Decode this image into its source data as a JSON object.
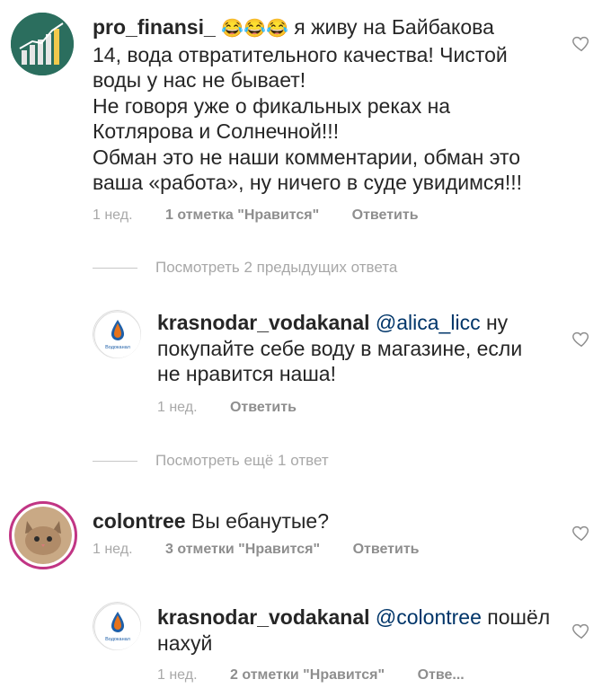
{
  "comments": {
    "c1": {
      "username": "pro_finansi_",
      "emojis": "😂😂😂",
      "text_lines": [
        "я живу на Байбакова",
        "14, вода отвратительного качества! Чистой",
        "воды у нас не бывает!",
        "Не говоря уже о фикальных реках на",
        "Котлярова и Солнечной!!!",
        "Обман это не наши комментарии, обман это",
        "ваша «работа», ну ничего в суде увидимся!!!"
      ],
      "time": "1 нед.",
      "likes": "1 отметка \"Нравится\"",
      "reply": "Ответить"
    },
    "view_prev": "Посмотреть 2 предыдущих ответа",
    "r1": {
      "username": "krasnodar_vodakanal",
      "mention": "@alica_licc",
      "text_lines": [
        "ну",
        "покупайте себе воду в магазине, если",
        "не нравится наша!"
      ],
      "time": "1 нед.",
      "reply": "Ответить",
      "logo_text": "Водоканал"
    },
    "view_more": "Посмотреть ещё 1 ответ",
    "c2": {
      "username": "colontree",
      "text": "Вы ебанутые?",
      "time": "1 нед.",
      "likes": "3 отметки \"Нравится\"",
      "reply": "Ответить"
    },
    "r2": {
      "username": "krasnodar_vodakanal",
      "mention": "@colontree",
      "text_lines": [
        "пошёл",
        "нахуй"
      ],
      "time": "1 нед.",
      "likes": "2 отметки \"Нравится\"",
      "reply": "Отве...",
      "logo_text": "Водоканал"
    }
  },
  "colors": {
    "text": "#262626",
    "meta": "#8e8e8e",
    "mention": "#003569",
    "divider": "#c7c7c7"
  },
  "icons": {
    "like": "heart-outline-icon"
  }
}
